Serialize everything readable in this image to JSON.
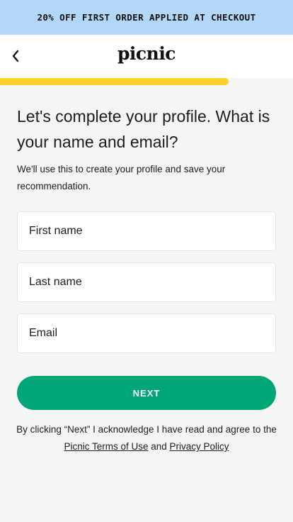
{
  "promo": {
    "text": "20% OFF FIRST ORDER APPLIED AT CHECKOUT"
  },
  "header": {
    "logo": "picnic",
    "back_icon": "chevron-left-icon"
  },
  "progress": {
    "fraction": 0.78,
    "color": "#f9d230"
  },
  "main": {
    "title": "Let's complete your profile. What is your name and email?",
    "subtitle": "We'll use this to create your profile and save your recommendation.",
    "fields": {
      "first_name": {
        "placeholder": "First name",
        "value": ""
      },
      "last_name": {
        "placeholder": "Last name",
        "value": ""
      },
      "email": {
        "placeholder": "Email",
        "value": ""
      }
    },
    "next_label": "NEXT",
    "accent_color": "#00a676"
  },
  "legal": {
    "prefix": "By clicking “Next” I acknowledge I have read and agree to the ",
    "terms_link": "Picnic Terms of Use",
    "and": " and ",
    "privacy_link": "Privacy Policy"
  }
}
